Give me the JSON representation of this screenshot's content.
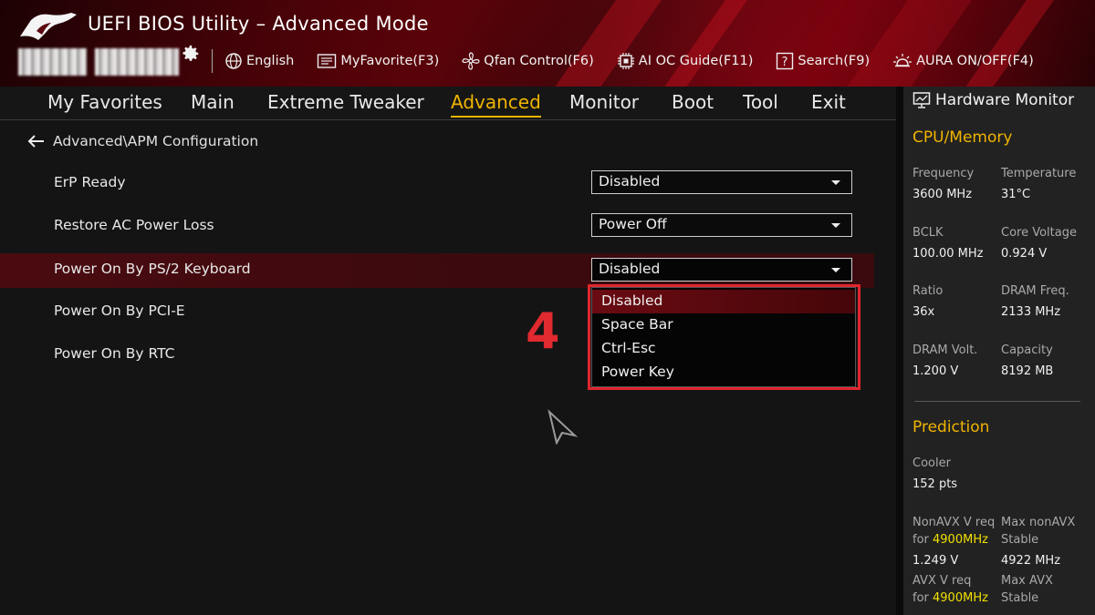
{
  "header": {
    "title": "UEFI BIOS Utility – Advanced Mode",
    "tools": [
      {
        "label": "English",
        "icon": "globe-icon"
      },
      {
        "label": "MyFavorite(F3)",
        "icon": "favorite-icon"
      },
      {
        "label": "Qfan Control(F6)",
        "icon": "fan-icon"
      },
      {
        "label": "AI OC Guide(F11)",
        "icon": "ai-oc-icon"
      },
      {
        "label": "Search(F9)",
        "icon": "search-icon"
      },
      {
        "label": "AURA ON/OFF(F4)",
        "icon": "aura-icon"
      }
    ]
  },
  "nav": {
    "tabs": [
      "My Favorites",
      "Main",
      "Extreme Tweaker",
      "Advanced",
      "Monitor",
      "Boot",
      "Tool",
      "Exit"
    ],
    "active": "Advanced"
  },
  "main": {
    "breadcrumb": "Advanced\\APM Configuration",
    "settings": [
      {
        "label": "ErP Ready",
        "value": "Disabled"
      },
      {
        "label": "Restore AC Power Loss",
        "value": "Power Off"
      },
      {
        "label": "Power On By PS/2 Keyboard",
        "value": "Disabled"
      },
      {
        "label": "Power On By PCI-E"
      },
      {
        "label": "Power On By RTC"
      }
    ],
    "dropdown_options": [
      "Disabled",
      "Space Bar",
      "Ctrl-Esc",
      "Power Key"
    ],
    "dropdown_selected": "Disabled",
    "annotation": "4"
  },
  "hardware_monitor": {
    "title": "Hardware Monitor",
    "cpu_section": "CPU/Memory",
    "cpu": {
      "frequency_label": "Frequency",
      "frequency": "3600 MHz",
      "temperature_label": "Temperature",
      "temperature": "31°C",
      "bclk_label": "BCLK",
      "bclk": "100.00 MHz",
      "core_voltage_label": "Core Voltage",
      "core_voltage": "0.924 V",
      "ratio_label": "Ratio",
      "ratio": "36x",
      "dram_freq_label": "DRAM Freq.",
      "dram_freq": "2133 MHz",
      "dram_volt_label": "DRAM Volt.",
      "dram_volt": "1.200 V",
      "capacity_label": "Capacity",
      "capacity": "8192 MB"
    },
    "prediction_section": "Prediction",
    "prediction": {
      "cooler_label": "Cooler",
      "cooler": "152 pts",
      "nonavx_req_label": "NonAVX V req",
      "for_label": "for",
      "nonavx_freq": "4900MHz",
      "nonavx_req": "1.249 V",
      "max_nonavx_label": "Max nonAVX",
      "stable_label": "Stable",
      "max_nonavx": "4922 MHz",
      "avx_req_label": "AVX V req",
      "avx_freq": "4900MHz",
      "max_avx_label": "Max AVX"
    }
  },
  "colors": {
    "accent": "#f0b400",
    "highlight": "#e0262f",
    "hw_value_highlight": "#f0e000"
  }
}
